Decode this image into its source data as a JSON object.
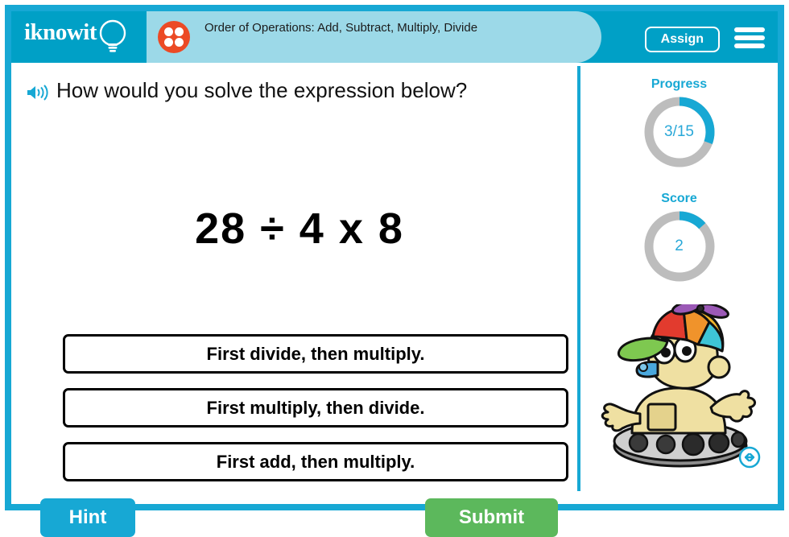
{
  "header": {
    "logo_text": "iknowit",
    "logo_icon": "lightbulb-icon",
    "lesson_icon": "dice-four-icon",
    "title": "Order of Operations: Add, Subtract, Multiply, Divide",
    "assign_label": "Assign",
    "menu_icon": "hamburger-menu-icon",
    "bg_color": "#00a0c6",
    "title_pill_color": "#9cd9e8",
    "dice_color": "#ec4a25"
  },
  "question": {
    "speaker_icon": "speaker-audio-icon",
    "prompt": "How would you solve the expression below?",
    "expression": "28 ÷ 4 x 8"
  },
  "answers": [
    {
      "label": "First divide, then multiply."
    },
    {
      "label": "First multiply, then divide."
    },
    {
      "label": "First add, then multiply."
    }
  ],
  "footer": {
    "hint_label": "Hint",
    "hint_color": "#17a8d4",
    "submit_label": "Submit",
    "submit_color": "#5cb85c"
  },
  "sidebar": {
    "progress": {
      "caption": "Progress",
      "value": "3/15",
      "current": 3,
      "total": 15,
      "percent": 20,
      "arc_degrees": 110,
      "arc_color": "#17a8d4",
      "track_color": "#bdbdbd"
    },
    "score": {
      "caption": "Score",
      "value": "2",
      "current": 2,
      "percent": 13,
      "arc_degrees": 48,
      "arc_color": "#17a8d4",
      "track_color": "#bdbdbd"
    },
    "mascot_icon": "robot-mascot-with-propeller-hat",
    "resize_icon": "horizontal-resize-arrows-icon"
  },
  "frame": {
    "border_color": "#17a8d4"
  }
}
